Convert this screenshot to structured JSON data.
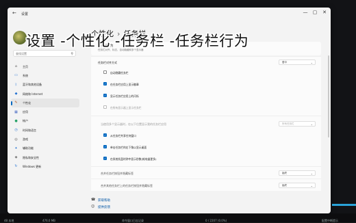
{
  "window": {
    "title": "设置",
    "back_icon": "back-arrow-icon",
    "controls": [
      "—",
      "▢",
      "✕"
    ]
  },
  "sidebar": {
    "search_placeholder": "查找设置",
    "items": [
      {
        "label": "主页",
        "icon": "home-icon",
        "glyph": "⌂",
        "color": "#555555"
      },
      {
        "label": "系统",
        "icon": "system-icon",
        "glyph": "▭",
        "color": "#1f6fd1"
      },
      {
        "label": "蓝牙和其他设备",
        "icon": "bluetooth-icon",
        "glyph": "ᛒ",
        "color": "#1f6fd1"
      },
      {
        "label": "网络和 Internet",
        "icon": "network-icon",
        "glyph": "◆",
        "color": "#1f6fd1"
      },
      {
        "label": "个性化",
        "icon": "brush-icon",
        "glyph": "✎",
        "color": "#b05a2a"
      },
      {
        "label": "应用",
        "icon": "apps-icon",
        "glyph": "▦",
        "color": "#3a5fbf"
      },
      {
        "label": "帐户",
        "icon": "account-icon",
        "glyph": "●",
        "color": "#2aa36a"
      },
      {
        "label": "时间和语言",
        "icon": "time-language-icon",
        "glyph": "◷",
        "color": "#1f6fd1"
      },
      {
        "label": "游戏",
        "icon": "game-icon",
        "glyph": "◎",
        "color": "#555555"
      },
      {
        "label": "辅助功能",
        "icon": "accessibility-icon",
        "glyph": "✦",
        "color": "#1f6fd1"
      },
      {
        "label": "隐私和安全性",
        "icon": "shield-icon",
        "glyph": "◈",
        "color": "#555555"
      },
      {
        "label": "Windows 更新",
        "icon": "update-icon",
        "glyph": "↻",
        "color": "#1f6fd1"
      }
    ],
    "active_index": 4
  },
  "main": {
    "breadcrumb": {
      "parent": "个性化",
      "sep": "›",
      "current": "任务栏"
    },
    "section": {
      "title": "任务栏行为",
      "subtitle": "任务栏对齐、标志、自动隐藏和多个显示器"
    },
    "alignment": {
      "label": "任务栏对齐方式",
      "value": "居中"
    },
    "checkboxes": [
      {
        "label": "自动隐藏任务栏",
        "checked": false,
        "disabled": false
      },
      {
        "label": "在任务栏应用上显示徽章",
        "checked": true,
        "disabled": false
      },
      {
        "label": "显示任务栏应用上的闪烁",
        "checked": true,
        "disabled": false
      },
      {
        "label": "在所有显示器上显示任务栏",
        "checked": false,
        "disabled": true
      }
    ],
    "multi_display": {
      "label": "当使用多个显示器时，在以下位置显示我的任务栏应用",
      "value": "所有任务栏"
    },
    "checkboxes2": [
      {
        "label": "从任务栏共享任何窗口",
        "checked": true,
        "disabled": false
      },
      {
        "label": "单击任务栏的右下角以显示桌面",
        "checked": true,
        "disabled": false
      },
      {
        "label": "在系统托盘时钟中显示秒数(耗电量更多)",
        "checked": true,
        "disabled": false
      }
    ],
    "combine": {
      "label": "合并任务栏按钮并隐藏标签",
      "value": "始终"
    },
    "combine_other": {
      "label": "合并其他任务栏上的任务栏按钮并隐藏标签",
      "value": "始终"
    },
    "links": [
      {
        "label": "获取帮助",
        "icon": "help-icon"
      },
      {
        "label": "提供反馈",
        "icon": "feedback-icon"
      }
    ]
  },
  "overlay_caption": "设置 -个性化 -任务栏 -任务栏行为",
  "bottom": {
    "texts": [
      "48 本地",
      "476.0 MB",
      "命令窗口日志记录",
      "0 / 2207 (0.0%)",
      "配置中断提示"
    ]
  }
}
